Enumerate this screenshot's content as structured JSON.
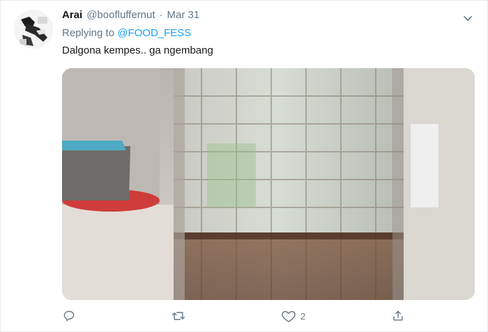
{
  "tweet": {
    "display_name": "Arai",
    "handle": "@boofluffernut",
    "separator": "·",
    "date": "Mar 31",
    "replying_prefix": "Replying to",
    "replying_to": "@FOOD_FESS",
    "text": "Dalgona kempes.. ga ngembang"
  },
  "actions": {
    "reply_icon": "reply-icon",
    "retweet_icon": "retweet-icon",
    "like_icon": "heart-icon",
    "like_count": "2",
    "share_icon": "share-icon"
  },
  "colors": {
    "link": "#1da1f2",
    "muted": "#657786",
    "text": "#14171a",
    "border": "#e6ecf0"
  }
}
